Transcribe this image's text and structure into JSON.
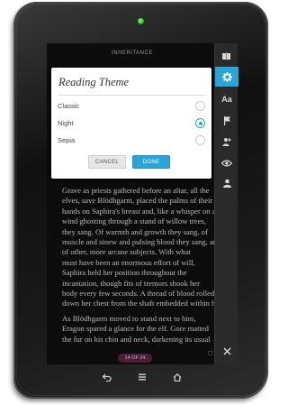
{
  "book": {
    "title": "INHERITANCE",
    "page_indicator": "14 OF 24",
    "paragraphs": [
      [
        "Grave as priests gathered before an altar, all the",
        "elves, save Blödhgarm, placed the palms of their",
        "hands on Saphira's breast and, like a whisper on a",
        "wind ghosting through a stand of willow trees,",
        "they sang. Of warmth and growth they sang, of",
        "muscle and sinew and pulsing blood they sang, and",
        "of other, more arcane subjects. With what",
        "must have been an enormous effort of will,",
        "Saphira held her position throughout the",
        "incantation, though fits of tremors shook her",
        "body every few seconds. A thread of blood rolled",
        "down her chest from the shaft embedded within her."
      ],
      [
        "As Blödhgarm moved to stand next to him,",
        "Eragon spared a glance for the elf. Gore matted",
        "the fur on his chin and neck, darkening its usual"
      ]
    ]
  },
  "dialog": {
    "title": "Reading Theme",
    "options": [
      {
        "label": "Classic",
        "selected": false
      },
      {
        "label": "Night",
        "selected": true
      },
      {
        "label": "Sepia",
        "selected": false
      }
    ],
    "cancel_label": "CANCEL",
    "done_label": "DONE"
  },
  "toolbar": {
    "items": [
      {
        "icon": "library-icon"
      },
      {
        "icon": "gear-icon",
        "active": true
      },
      {
        "icon": "font-size-icon",
        "label": "Aa"
      },
      {
        "icon": "bookmark-flag-icon"
      },
      {
        "icon": "share-icon"
      },
      {
        "icon": "eye-icon"
      },
      {
        "icon": "person-icon"
      },
      {
        "icon": "close-icon"
      }
    ]
  },
  "nav_keys": [
    "back-icon",
    "menu-icon",
    "home-icon"
  ],
  "colors": {
    "accent": "#2aa5d9",
    "page_indicator_bg": "#4a1f35",
    "screen_bg": "#0c0c0c",
    "text": "#b9b9b9"
  }
}
